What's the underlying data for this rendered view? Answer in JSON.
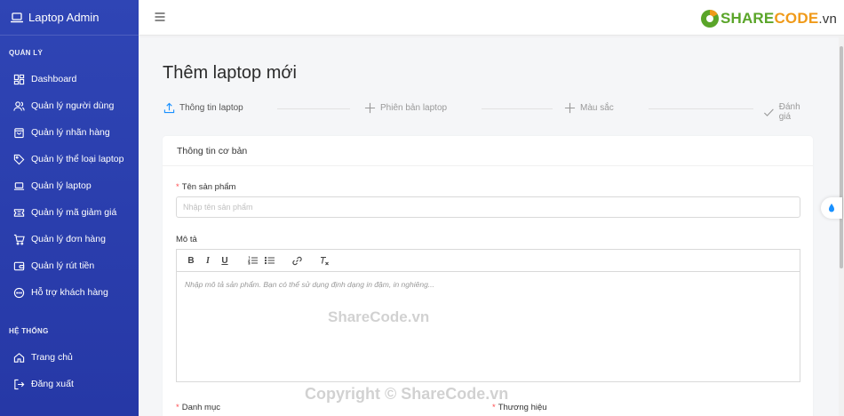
{
  "brand": {
    "title": "Laptop Admin"
  },
  "sidebar": {
    "section1": "QUẢN LÝ",
    "items": [
      {
        "label": "Dashboard",
        "icon": "dashboard-icon"
      },
      {
        "label": "Quản lý người dùng",
        "icon": "users-icon"
      },
      {
        "label": "Quản lý nhãn hàng",
        "icon": "shopping-bag-icon"
      },
      {
        "label": "Quản lý thể loại laptop",
        "icon": "tag-icon"
      },
      {
        "label": "Quản lý laptop",
        "icon": "laptop-icon"
      },
      {
        "label": "Quản lý mã giảm giá",
        "icon": "ticket-icon"
      },
      {
        "label": "Quản lý đơn hàng",
        "icon": "cart-icon"
      },
      {
        "label": "Quản lý rút tiền",
        "icon": "wallet-icon"
      },
      {
        "label": "Hỗ trợ khách hàng",
        "icon": "chat-icon"
      }
    ],
    "section2": "HỆ THỐNG",
    "items2": [
      {
        "label": "Trang chủ",
        "icon": "home-icon"
      },
      {
        "label": "Đăng xuất",
        "icon": "logout-icon"
      }
    ]
  },
  "header": {
    "logo": {
      "share": "SHARE",
      "code": "CODE",
      "vn": ".vn"
    }
  },
  "page": {
    "title": "Thêm laptop mới"
  },
  "steps": [
    {
      "label": "Thông tin laptop"
    },
    {
      "label": "Phiên bản laptop"
    },
    {
      "label": "Màu sắc"
    },
    {
      "label": "Đánh giá"
    }
  ],
  "card": {
    "header": "Thông tin cơ bản",
    "name_label": "Tên sản phẩm",
    "name_placeholder": "Nhập tên sản phẩm",
    "desc_label": "Mô tả",
    "desc_placeholder": "Nhập mô tả sản phẩm. Bạn có thể sử dụng định dạng in đậm, in nghiêng...",
    "category_label": "Danh mục",
    "brand_label": "Thương hiệu"
  },
  "toolbar": {
    "bold": "B",
    "italic": "I",
    "underline": "U"
  },
  "watermarks": {
    "center": "ShareCode.vn",
    "bottom": "Copyright © ShareCode.vn"
  },
  "colors": {
    "sidebar": "#2f45b5",
    "accent": "#1890ff",
    "required": "#ff4d4f"
  }
}
